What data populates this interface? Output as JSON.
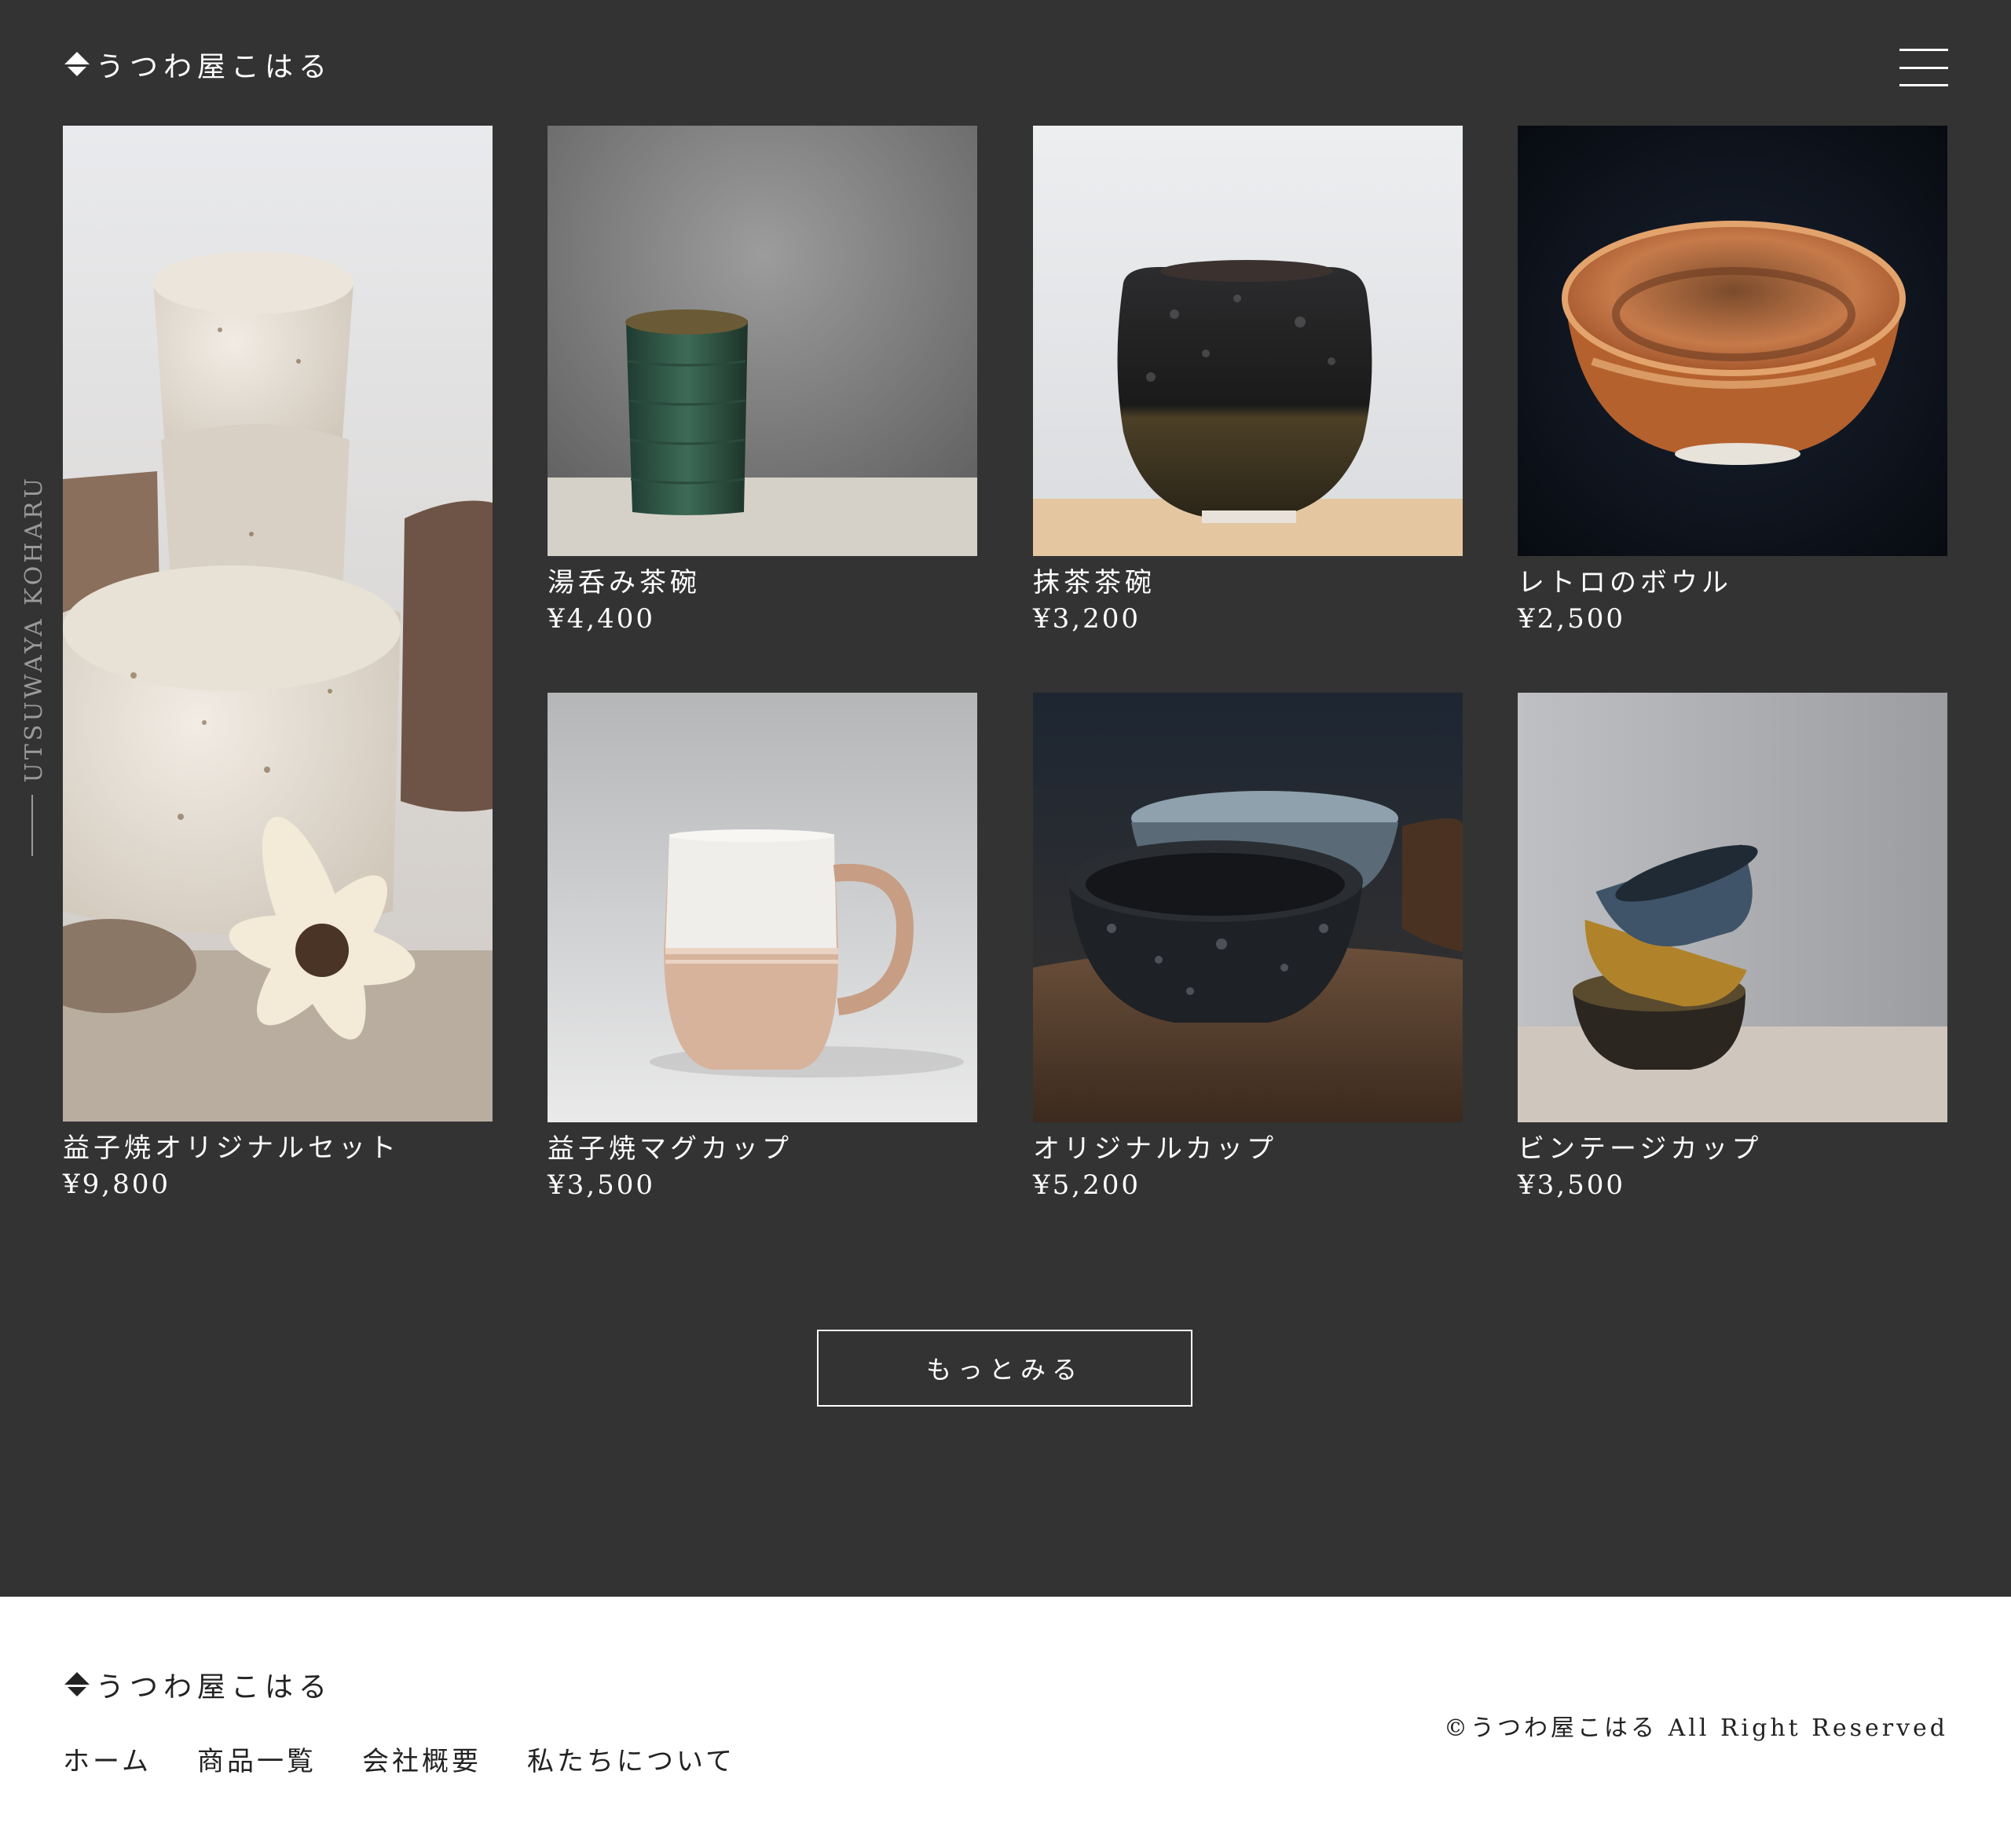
{
  "header": {
    "logo_text": "うつわ屋こはる",
    "menu_icon": "hamburger-menu-icon"
  },
  "side_label": "UTSUWAYA KOHARU",
  "products": [
    {
      "name": "益子焼オリジナルセット",
      "price": "¥9,800"
    },
    {
      "name": "湯呑み茶碗",
      "price": "¥4,400"
    },
    {
      "name": "抹茶茶碗",
      "price": "¥3,200"
    },
    {
      "name": "レトロのボウル",
      "price": "¥2,500"
    },
    {
      "name": "益子焼マグカップ",
      "price": "¥3,500"
    },
    {
      "name": "オリジナルカップ",
      "price": "¥5,200"
    },
    {
      "name": "ビンテージカップ",
      "price": "¥3,500"
    }
  ],
  "more_button": "もっとみる",
  "footer": {
    "logo_text": "うつわ屋こはる",
    "nav": [
      "ホーム",
      "商品一覧",
      "会社概要",
      "私たちについて"
    ],
    "copyright": "©うつわ屋こはる All Right Reserved"
  },
  "colors": {
    "background": "#333333",
    "footer_background": "#ffffff",
    "text_light": "#ffffff",
    "text_dark": "#222222"
  }
}
